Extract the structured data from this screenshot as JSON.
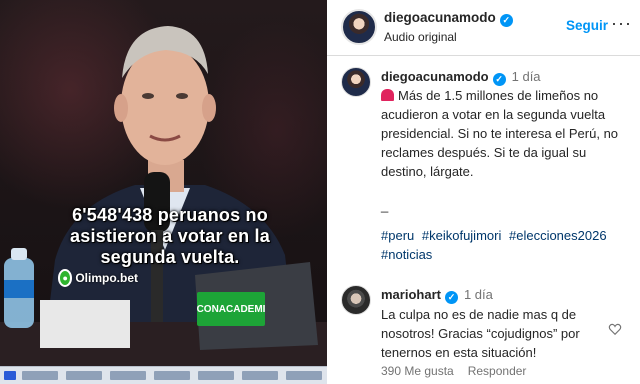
{
  "video": {
    "caption_line1": "6'548'438 peruanos no",
    "caption_line2": "asistieron a votar en la",
    "caption_line3": "segunda vuelta.",
    "brand": "Olimpo.bet",
    "banner": "CONACADEMI"
  },
  "header": {
    "username": "diegoacunamodo",
    "subtitle": "Audio original",
    "follow_label": "Seguir",
    "more_label": "···"
  },
  "post": {
    "username": "diegoacunamodo",
    "time": "1 día",
    "text": "Más de 1.5 millones de limeños no acudieron a votar en la segunda vuelta presidencial. Si no te interesa el Perú, no reclames después. Si te da igual su destino, lárgate.",
    "separator": "_",
    "hashtags": [
      "#peru",
      "#keikofujimori",
      "#elecciones2026",
      "#noticias"
    ]
  },
  "comment": {
    "username": "mariohart",
    "time": "1 día",
    "text": "La culpa no es de nadie mas q de nosotros! Gracias “cojudignos” por tenernos en esta situación!",
    "likes": "390 Me gusta",
    "reply_label": "Responder"
  },
  "colors": {
    "accent": "#0095f6",
    "link": "#00376b",
    "verified": "#0095f6"
  }
}
